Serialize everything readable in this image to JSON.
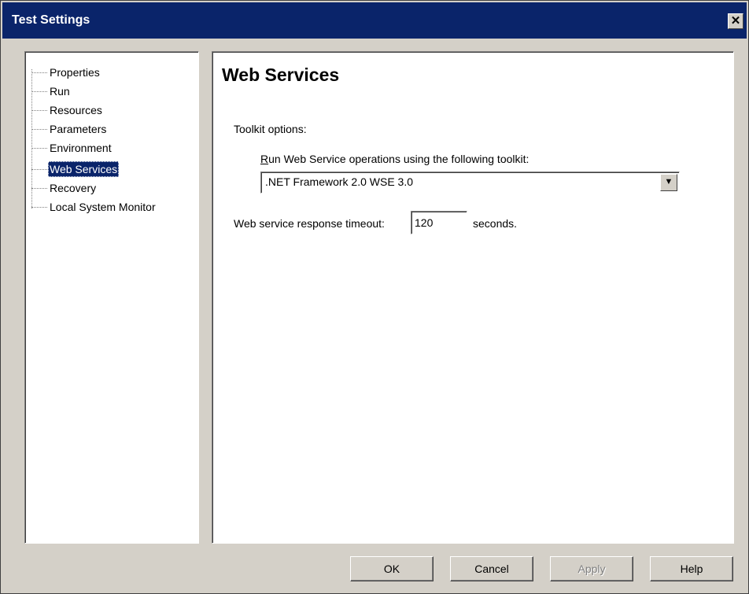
{
  "window": {
    "title": "Test Settings",
    "close_glyph": "✕"
  },
  "tree": {
    "items": [
      {
        "label": "Properties",
        "selected": false
      },
      {
        "label": "Run",
        "selected": false
      },
      {
        "label": "Resources",
        "selected": false
      },
      {
        "label": "Parameters",
        "selected": false
      },
      {
        "label": "Environment",
        "selected": false
      },
      {
        "label": "Web Services",
        "selected": true
      },
      {
        "label": "Recovery",
        "selected": false
      },
      {
        "label": "Local System Monitor",
        "selected": false
      }
    ]
  },
  "content": {
    "heading": "Web Services",
    "toolkit_section_label": "Toolkit options:",
    "toolkit_label_mnemonic": "R",
    "toolkit_label_rest": "un Web Service operations using the following toolkit:",
    "toolkit_selected": ".NET Framework 2.0 WSE 3.0",
    "timeout_label": "Web service response timeout:",
    "timeout_value": "120",
    "timeout_unit": "seconds."
  },
  "buttons": {
    "ok": "OK",
    "cancel": "Cancel",
    "apply": "Apply",
    "help": "Help"
  },
  "colors": {
    "titlebar": "#0a246a",
    "selection": "#0a246a",
    "dialog_background": "#d4d0c8"
  },
  "icons": {
    "close": "close-icon",
    "dropdown": "chevron-down-icon"
  }
}
